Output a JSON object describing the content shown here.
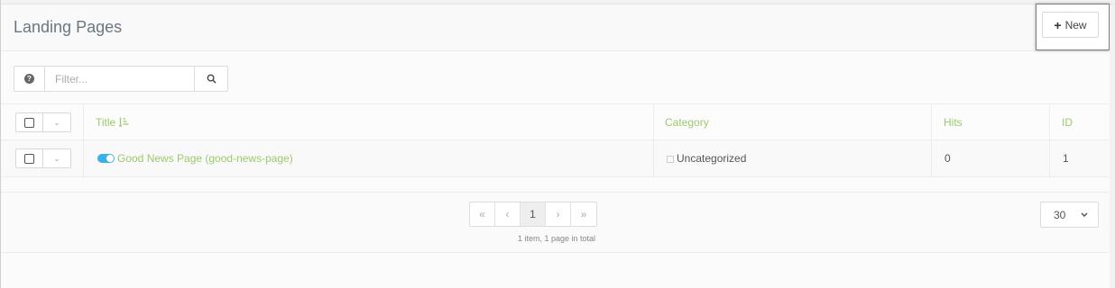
{
  "header": {
    "title": "Landing Pages",
    "new_label": "New"
  },
  "filter": {
    "placeholder": "Filter..."
  },
  "table": {
    "columns": {
      "title": "Title",
      "category": "Category",
      "hits": "Hits",
      "id": "ID"
    },
    "rows": [
      {
        "title": "Good News Page (good-news-page)",
        "category": "Uncategorized",
        "hits": "0",
        "id": "1"
      }
    ]
  },
  "pagination": {
    "first": "«",
    "prev": "‹",
    "current": "1",
    "next": "›",
    "last": "»",
    "info": "1 item, 1 page in total",
    "per_page": "30"
  },
  "icons": {
    "new": "plus-icon",
    "help": "question-circle-icon",
    "search": "search-icon",
    "sort": "sort-amount-icon",
    "toggle": "toggle-on-icon"
  },
  "colors": {
    "link": "#9cca6e",
    "toggle": "#3bb0e8"
  }
}
